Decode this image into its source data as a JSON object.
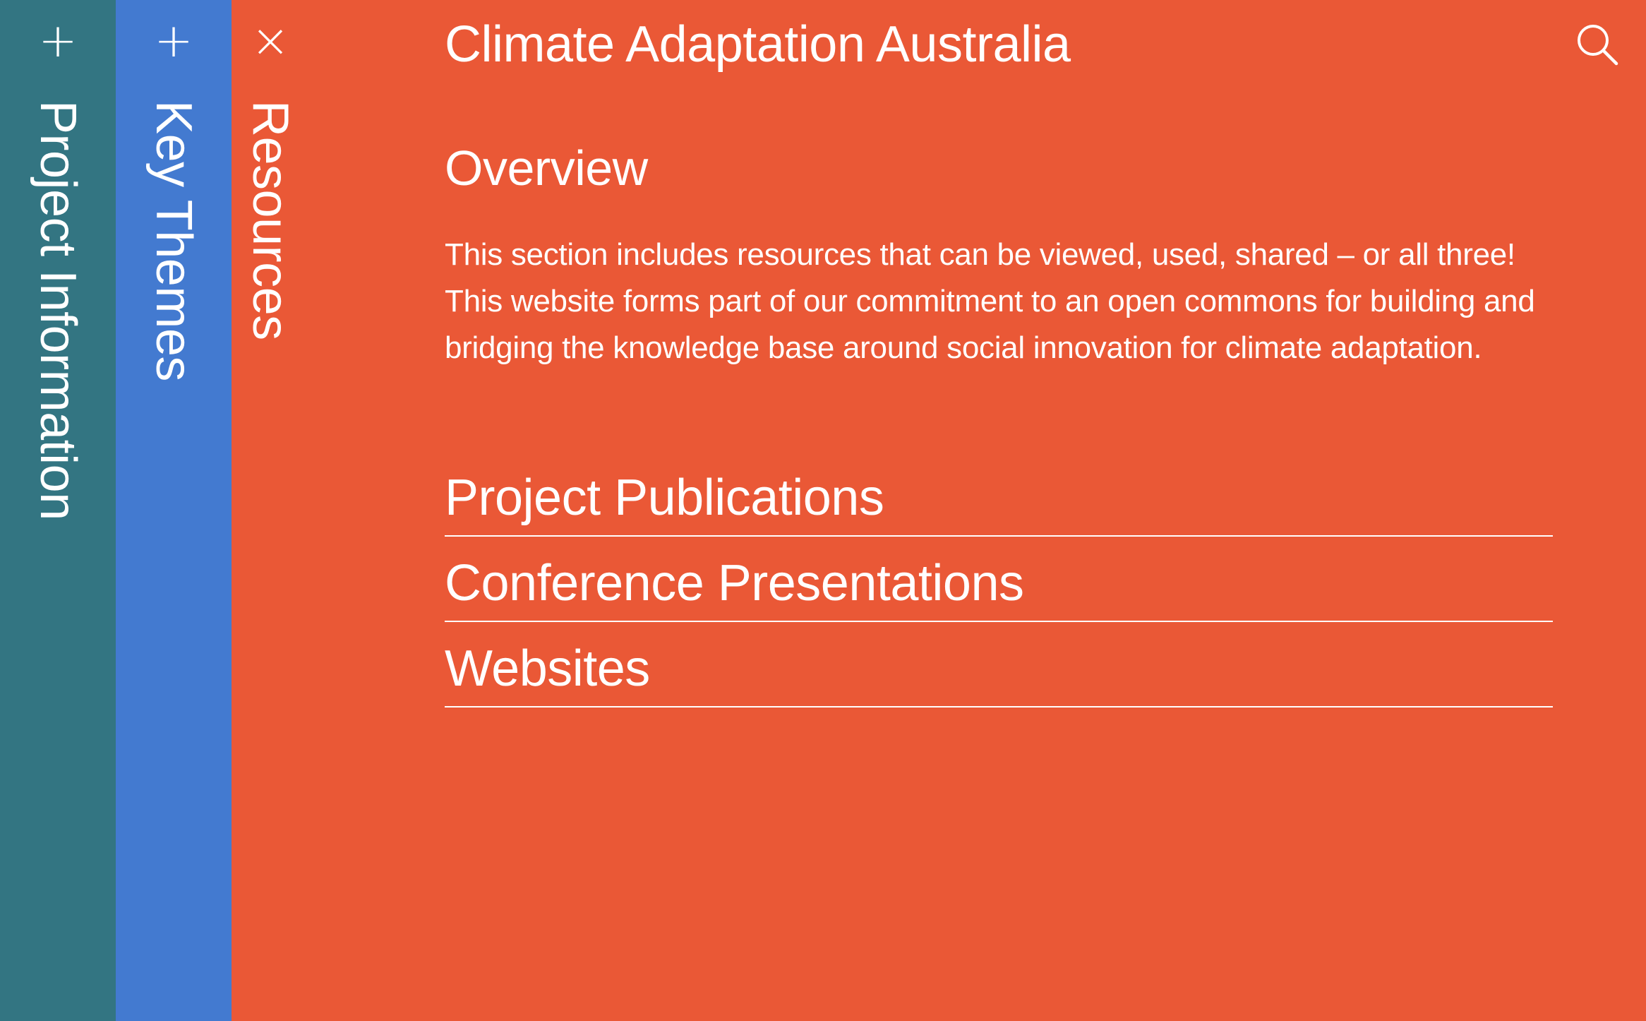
{
  "tabs": [
    {
      "toggle": "+",
      "label": "Project Information"
    },
    {
      "toggle": "+",
      "label": "Key Themes"
    },
    {
      "toggle": "×",
      "label": "Resources"
    }
  ],
  "header": {
    "site_title": "Climate Adaptation Australia",
    "search_icon": "search-icon"
  },
  "main": {
    "overview_heading": "Overview",
    "overview_text": "This section includes resources that can be viewed, used, shared – or all three! This website forms part of our commitment to an open commons for building and bridging the knowledge base around social innovation for climate adaptation.",
    "resources": [
      {
        "label": "Project Publications"
      },
      {
        "label": "Conference Presentations"
      },
      {
        "label": "Websites"
      }
    ]
  },
  "colors": {
    "project_tab": "#337582",
    "themes_tab": "#437ad0",
    "resources_bg": "#ea5836",
    "text": "#ffffff"
  }
}
